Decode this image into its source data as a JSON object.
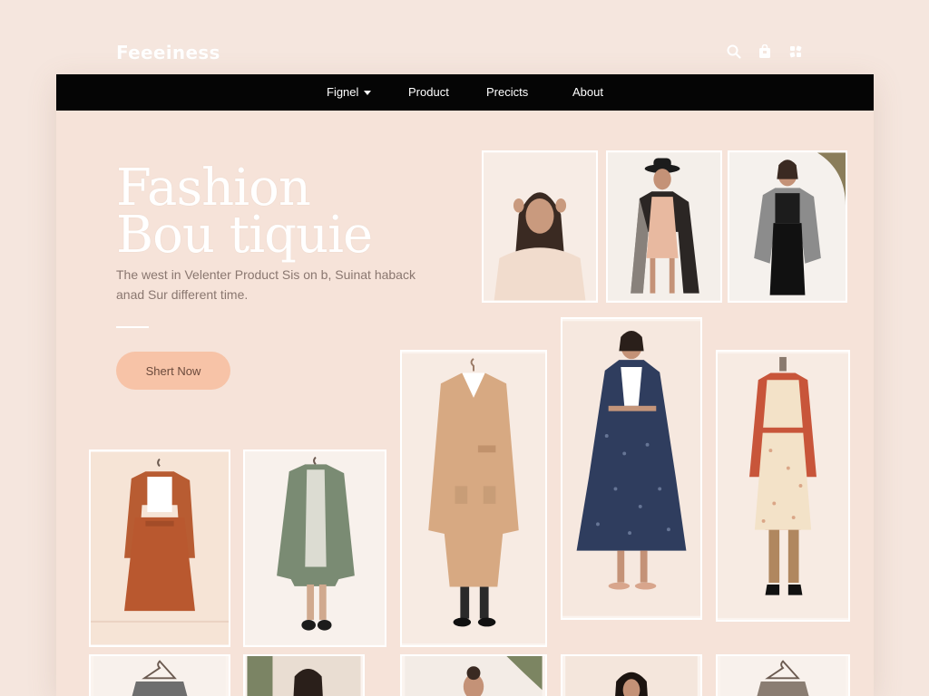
{
  "brand": {
    "name": "Feeeiness"
  },
  "top_icons": [
    "search-icon",
    "bag-icon",
    "grid-icon"
  ],
  "nav": {
    "items": [
      {
        "label": "Fignel",
        "has_dropdown": true
      },
      {
        "label": "Product",
        "has_dropdown": false
      },
      {
        "label": "Precicts",
        "has_dropdown": false
      },
      {
        "label": "About",
        "has_dropdown": false
      }
    ]
  },
  "hero": {
    "title_line1": "Fashion",
    "title_line2": "Bou tiquie",
    "subtitle": "The west in Velenter Product Sis on b, Suinat haback anad Sur different time.",
    "cta_label": "Shert Now"
  },
  "colors": {
    "background": "#f5e6de",
    "panel": "#f6e3d9",
    "navbar": "#050505",
    "cta": "#f7c3a7",
    "hero_text": "#ffffff"
  },
  "products": [
    {
      "id": "model-cream-sweater"
    },
    {
      "id": "model-hat-plaid-coat"
    },
    {
      "id": "model-grey-blazer"
    },
    {
      "id": "camel-wrap-coat"
    },
    {
      "id": "navy-floral-coat-dress"
    },
    {
      "id": "floral-apron-dress-rust-cardigan"
    },
    {
      "id": "rust-jacket-skirt-set"
    },
    {
      "id": "sage-green-coat"
    },
    {
      "id": "hanger-item-bottom-1"
    },
    {
      "id": "model-bottom-2"
    },
    {
      "id": "model-bottom-3"
    },
    {
      "id": "model-bottom-4"
    },
    {
      "id": "hanger-item-bottom-5"
    }
  ]
}
